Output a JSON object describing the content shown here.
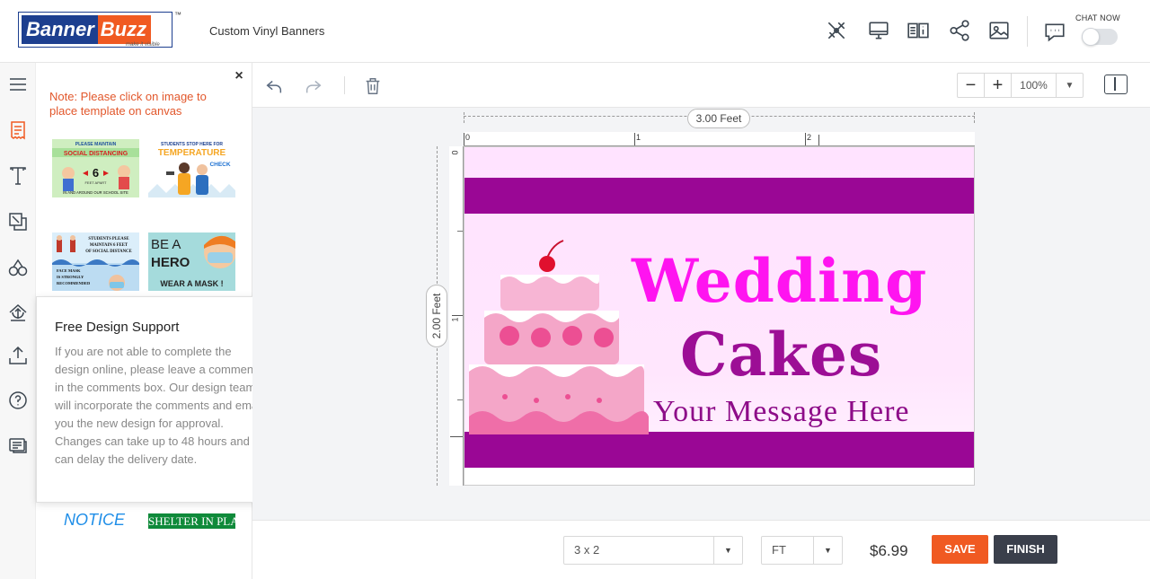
{
  "header": {
    "logo_part1": "Banner",
    "logo_part2": "Buzz",
    "logo_tm": "™",
    "logo_tagline": "make it visible",
    "page_title": "Custom Vinyl Banners",
    "icons": [
      "design-tools-icon",
      "desktop-preview-icon",
      "product-info-icon",
      "share-icon",
      "image-icon"
    ],
    "chat_label": "CHAT NOW",
    "chat_enabled": false
  },
  "rail": {
    "items": [
      "menu-icon",
      "templates-icon",
      "text-icon",
      "shapes-icon",
      "cliparts-icon",
      "background-icon",
      "upload-icon",
      "help-icon",
      "comments-icon"
    ],
    "active": "templates-icon"
  },
  "panel": {
    "close_label": "×",
    "note": "Note: Please click on image to place template on canvas",
    "thumbnails": [
      {
        "line1": "PLEASE MAINTAIN",
        "line2": "SOCIAL DISTANCING",
        "line3": "6",
        "line4": "FEET APART",
        "line5": "IN AND AROUND OUR SCHOOL SITE"
      },
      {
        "line1": "STUDENTS STOP HERE FOR",
        "line2": "TEMPERATURE",
        "line3": "CHECK"
      },
      {
        "line1": "STUDENTS PLEASE",
        "line2": "MAINTAIN 6 FEET",
        "line3": "OF SOCIAL DISTANCE",
        "line4": "FACE MASK",
        "line5": "IS STRONGLY",
        "line6": "RECOMMENDED"
      },
      {
        "line1": "BE A",
        "line2": "HERO",
        "line3": "WEAR A MASK !"
      }
    ],
    "bottom_thumb1": "NOTICE",
    "bottom_thumb2": "SHELTER IN PLACE"
  },
  "support": {
    "close_label": "×",
    "title": "Free Design Support",
    "body": "If you are not able to complete the design online, please leave a comments in the comments box. Our design team will incorporate the comments and email you the new design for approval. Changes can take up to 48 hours and can delay the delivery date."
  },
  "toolbar": {
    "zoom_minus": "−",
    "zoom_plus": "+",
    "zoom_value": "100%"
  },
  "canvas": {
    "width_label": "3.00 Feet",
    "height_label": "2.00 Feet",
    "ruler_h": [
      "0",
      "1",
      "2"
    ],
    "ruler_v": [
      "0",
      "1"
    ],
    "banner": {
      "title1": "Wedding",
      "title2": "Cakes",
      "message": "Your Message Here",
      "stripe_color": "#9a0795",
      "title1_color": "#ff14f0",
      "title2_color": "#9c0e95"
    }
  },
  "bottom": {
    "size_value": "3 x 2",
    "unit_value": "FT",
    "price": "$6.99",
    "save_label": "SAVE",
    "finish_label": "FINISH"
  }
}
